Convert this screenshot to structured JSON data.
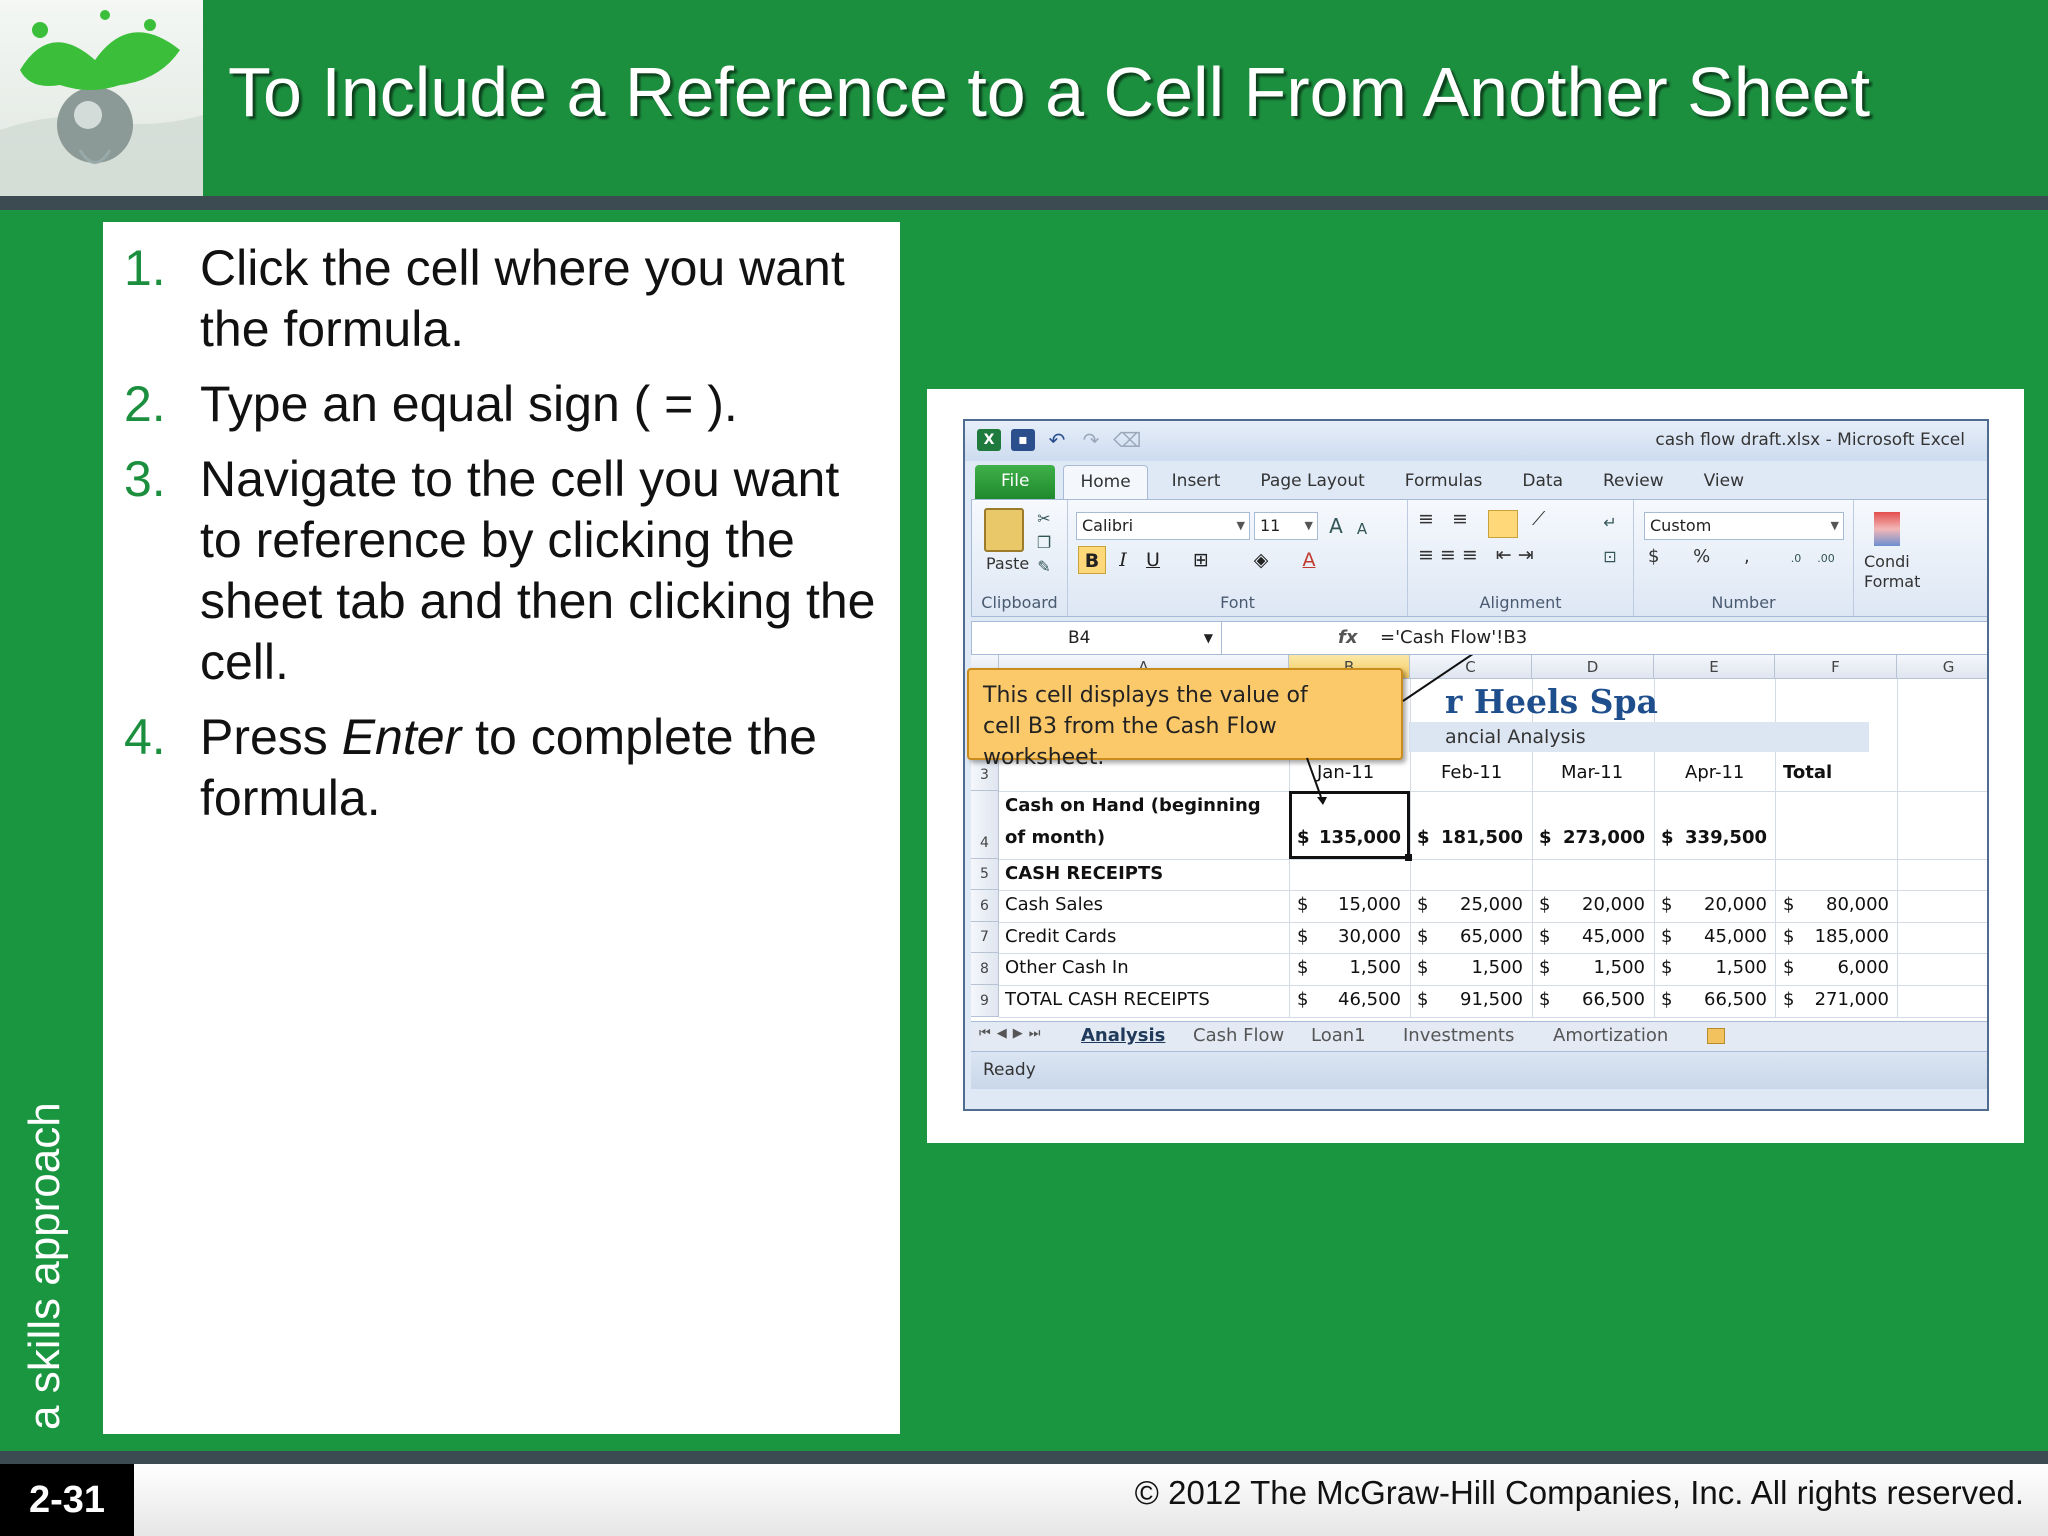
{
  "slide": {
    "title": "To Include a Reference to a Cell From Another Sheet",
    "side_text": "a skills approach",
    "page_number": "2-31",
    "copyright": "© 2012 The McGraw-Hill Companies, Inc. All rights reserved."
  },
  "steps": [
    {
      "num": "1.",
      "text": "Click the cell where you want the formula."
    },
    {
      "num": "2.",
      "text": "Type an equal sign ( = )."
    },
    {
      "num": "3.",
      "text": "Navigate to the cell you want to reference by clicking the sheet tab and then clicking the cell."
    },
    {
      "num": "4.",
      "pre": "Press ",
      "em": "Enter",
      "post": " to complete the formula."
    }
  ],
  "excel": {
    "window_title": "cash flow draft.xlsx - Microsoft Excel",
    "tabs": [
      "File",
      "Home",
      "Insert",
      "Page Layout",
      "Formulas",
      "Data",
      "Review",
      "View"
    ],
    "active_tab": "Home",
    "ribbon": {
      "paste_label": "Paste",
      "clipboard_label": "Clipboard",
      "font_name": "Calibri",
      "font_size": "11",
      "font_label": "Font",
      "alignment_label": "Alignment",
      "number_format": "Custom",
      "number_label": "Number",
      "conditional_label_1": "Condi",
      "conditional_label_2": "Format",
      "bold": "B",
      "italic": "I",
      "underline": "U"
    },
    "name_box": "B4",
    "fx": "fx",
    "formula": "='Cash Flow'!B3",
    "columns": [
      "A",
      "B",
      "C",
      "D",
      "E",
      "F",
      "G"
    ],
    "selected_column": "B",
    "rows": [
      "3",
      "4",
      "5",
      "6",
      "7",
      "8",
      "9"
    ],
    "spa_title": "r Heels Spa",
    "spa_subtitle": "ancial Analysis",
    "months": [
      "Jan-11",
      "Feb-11",
      "Mar-11",
      "Apr-11"
    ],
    "total_label": "Total",
    "cash_on_hand_line1": "Cash on Hand (beginning",
    "cash_on_hand_line2": "of month)",
    "cash_on_hand": [
      "135,000",
      "181,500",
      "273,000",
      "339,500"
    ],
    "cash_receipts_label": "CASH RECEIPTS",
    "data_rows": [
      {
        "label": "Cash Sales",
        "values": [
          "15,000",
          "25,000",
          "20,000",
          "20,000",
          "80,000"
        ]
      },
      {
        "label": "Credit Cards",
        "values": [
          "30,000",
          "65,000",
          "45,000",
          "45,000",
          "185,000"
        ]
      },
      {
        "label": "Other Cash In",
        "values": [
          "1,500",
          "1,500",
          "1,500",
          "1,500",
          "6,000"
        ]
      },
      {
        "label": "TOTAL CASH RECEIPTS",
        "values": [
          "46,500",
          "91,500",
          "66,500",
          "66,500",
          "271,000"
        ]
      }
    ],
    "currency_symbol": "$",
    "callout_line1": "This cell displays the value of",
    "callout_line2": "cell B3 from the Cash Flow worksheet.",
    "sheet_tabs": [
      "Analysis",
      "Cash Flow",
      "Loan1",
      "Investments",
      "Amortization"
    ],
    "active_sheet": "Analysis",
    "status": "Ready"
  },
  "colors": {
    "slide_green": "#1a9540",
    "title_green": "#1c8f3f",
    "rule_gray": "#3c4a52",
    "callout_fill": "#fbc96a"
  }
}
